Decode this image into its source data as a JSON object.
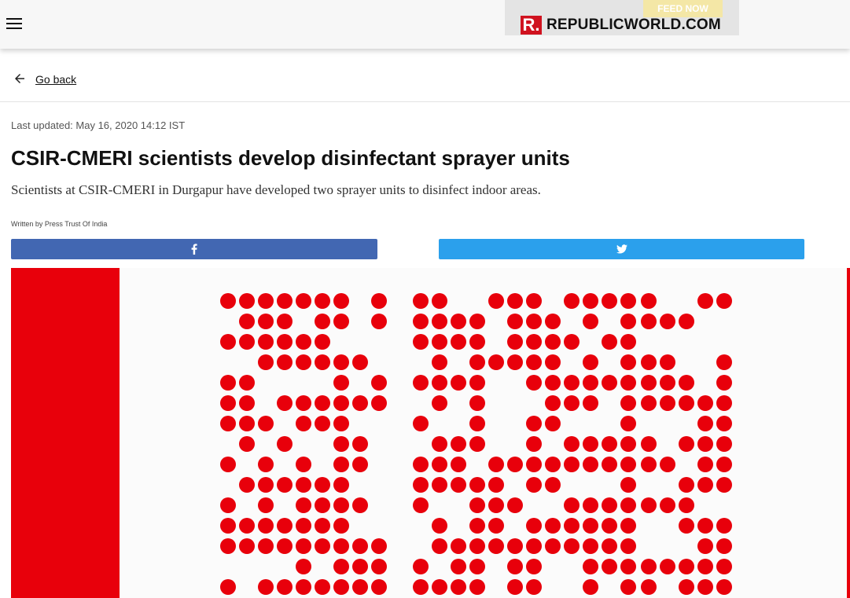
{
  "header": {
    "menu_icon": "hamburger-menu-icon",
    "logo": {
      "mark": "R.",
      "text": "REPUBLICWORLD.COM",
      "banner": "FEED NOW",
      "brand_color": "#d0121f"
    }
  },
  "nav": {
    "back_icon": "arrow-left-icon",
    "back_label": "Go back"
  },
  "article": {
    "last_updated": "Last updated: May 16, 2020 14:12 IST",
    "title": "CSIR-CMERI scientists develop disinfectant sprayer units",
    "subtitle": "Scientists at CSIR-CMERI in Durgapur have developed two sprayer units to disinfect indoor areas.",
    "byline": "Written by Press Trust Of India"
  },
  "share": {
    "facebook": {
      "icon": "facebook-icon",
      "color": "#4267b2"
    },
    "twitter": {
      "icon": "twitter-icon",
      "color": "#2ba0ec"
    }
  },
  "hero_image": {
    "description_icon": "pti-logo-image",
    "accent": "#e8000b"
  }
}
